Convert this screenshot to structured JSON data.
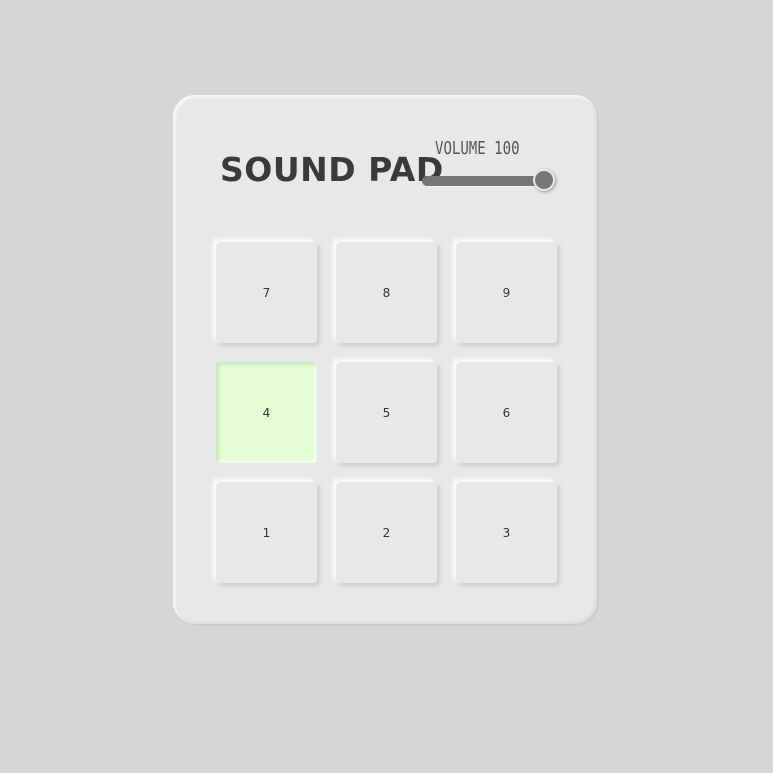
{
  "app": {
    "title": "SOUND PAD"
  },
  "volume": {
    "label": "VOLUME 100",
    "value": 100,
    "max": 100
  },
  "pads": [
    {
      "label": "7",
      "active": false
    },
    {
      "label": "8",
      "active": false
    },
    {
      "label": "9",
      "active": false
    },
    {
      "label": "4",
      "active": true
    },
    {
      "label": "5",
      "active": false
    },
    {
      "label": "6",
      "active": false
    },
    {
      "label": "1",
      "active": false
    },
    {
      "label": "2",
      "active": false
    },
    {
      "label": "3",
      "active": false
    }
  ],
  "colors": {
    "background": "#d6d6d6",
    "device": "#e8e8e8",
    "active_pad": "#e4fdd4",
    "text": "#3a3a3a",
    "slider": "#777777"
  }
}
